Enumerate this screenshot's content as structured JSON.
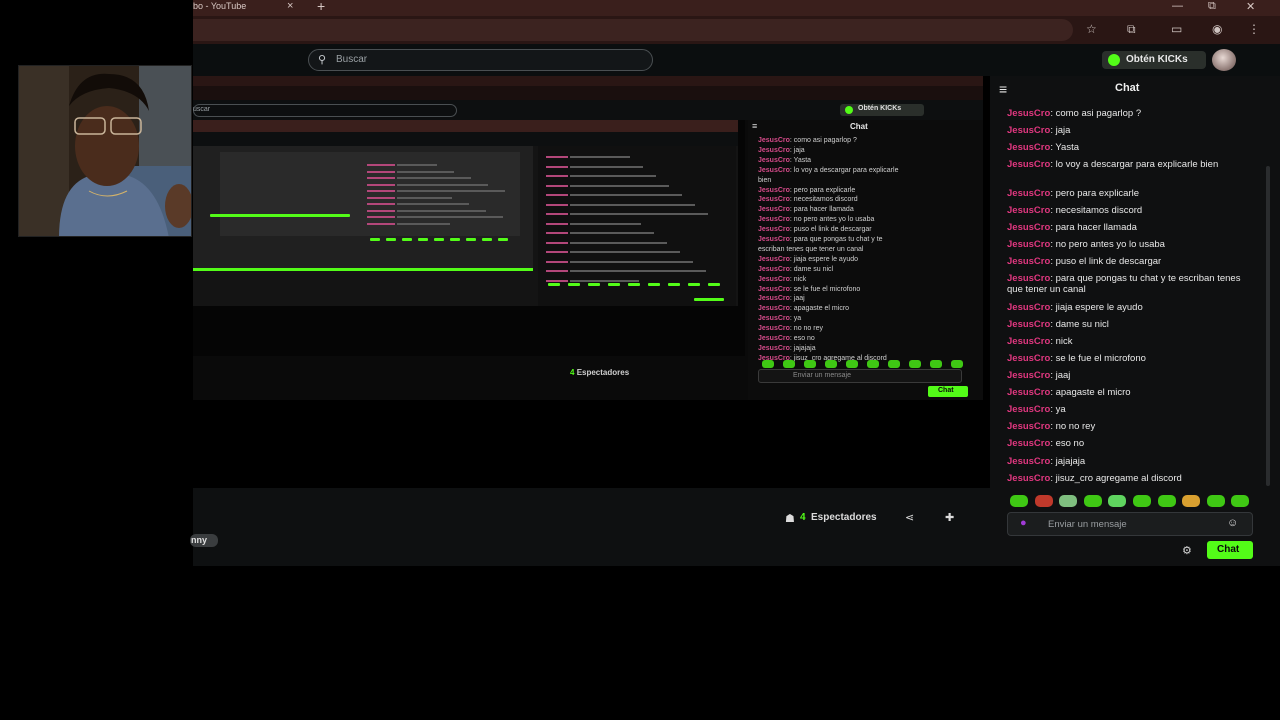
{
  "browser": {
    "tab_title": "bo - YouTube",
    "tab_close": "×",
    "tab_new": "+",
    "win_minimize": "—",
    "win_restore": "⧉",
    "win_close": "✕"
  },
  "header": {
    "search_placeholder": "Buscar",
    "kicks_label": "Obtén KICKs"
  },
  "nested": {
    "search_text": "uscar",
    "kicks_label": "Obtén KICKs",
    "chat_title": "Chat",
    "spect_count": "4",
    "spect_label": "Espectadores",
    "input_placeholder": "Enviar un mensaje",
    "chat_button": "Chat",
    "messages": [
      {
        "user": "JesusCro",
        "text": ": como asi pagarlop ?"
      },
      {
        "user": "JesusCro",
        "text": ": jaja"
      },
      {
        "user": "JesusCro",
        "text": ": Yasta"
      },
      {
        "user": "JesusCro",
        "text": ": lo voy a descargar para explicarle"
      },
      {
        "user": "",
        "text": "bien"
      },
      {
        "user": "JesusCro",
        "text": ": pero para explicarle"
      },
      {
        "user": "JesusCro",
        "text": ": necesitamos discord"
      },
      {
        "user": "JesusCro",
        "text": ": para hacer llamada"
      },
      {
        "user": "JesusCro",
        "text": ": no pero antes yo lo usaba"
      },
      {
        "user": "JesusCro",
        "text": ": puso el link de descargar"
      },
      {
        "user": "JesusCro",
        "text": ": para que pongas tu chat y te"
      },
      {
        "user": "",
        "text": "escriban tenes que tener un canal"
      },
      {
        "user": "JesusCro",
        "text": ": jiaja espere le ayudo"
      },
      {
        "user": "JesusCro",
        "text": ": dame su nicl"
      },
      {
        "user": "JesusCro",
        "text": ": nick"
      },
      {
        "user": "JesusCro",
        "text": ": se le fue el microfono"
      },
      {
        "user": "JesusCro",
        "text": ": jaaj"
      },
      {
        "user": "JesusCro",
        "text": ": apagaste el micro"
      },
      {
        "user": "JesusCro",
        "text": ": ya"
      },
      {
        "user": "JesusCro",
        "text": ": no no rey"
      },
      {
        "user": "JesusCro",
        "text": ": eso no"
      },
      {
        "user": "JesusCro",
        "text": ": jajajaja"
      },
      {
        "user": "JesusCro",
        "text": ": jisuz_cro agregame al discord"
      }
    ]
  },
  "stream_info": {
    "spect_count": "4",
    "spect_label": "Espectadores",
    "name_tag": "nny"
  },
  "chat": {
    "title": "Chat",
    "input_placeholder": "Enviar un mensaje",
    "send_button": "Chat",
    "username_color": "#e0377f",
    "accent": "#53fc18",
    "messages": [
      {
        "user": "JesusCro",
        "text": ": como asi pagarlop ?"
      },
      {
        "user": "JesusCro",
        "text": ": jaja"
      },
      {
        "user": "JesusCro",
        "text": ": Yasta"
      },
      {
        "user": "JesusCro",
        "text": ": lo voy a descargar para explicarle bien"
      },
      {
        "user": "JesusCro",
        "text": ": pero para explicarle"
      },
      {
        "user": "JesusCro",
        "text": ": necesitamos discord"
      },
      {
        "user": "JesusCro",
        "text": ": para hacer llamada"
      },
      {
        "user": "JesusCro",
        "text": ": no pero antes yo lo usaba"
      },
      {
        "user": "JesusCro",
        "text": ": puso el link de descargar"
      },
      {
        "user": "JesusCro",
        "text": ": para que pongas tu chat y te escriban tenes que tener un canal"
      },
      {
        "user": "JesusCro",
        "text": ": jiaja espere le ayudo"
      },
      {
        "user": "JesusCro",
        "text": ": dame su nicl"
      },
      {
        "user": "JesusCro",
        "text": ": nick"
      },
      {
        "user": "JesusCro",
        "text": ": se le fue el microfono"
      },
      {
        "user": "JesusCro",
        "text": ": jaaj"
      },
      {
        "user": "JesusCro",
        "text": ": apagaste el micro"
      },
      {
        "user": "JesusCro",
        "text": ": ya"
      },
      {
        "user": "JesusCro",
        "text": ": no no rey"
      },
      {
        "user": "JesusCro",
        "text": ": eso no"
      },
      {
        "user": "JesusCro",
        "text": ": jajajaja"
      },
      {
        "user": "JesusCro",
        "text": ": jisuz_cro agregame al discord"
      }
    ],
    "emotes": [
      "emote-1",
      "emote-2",
      "emote-3",
      "emote-4",
      "emote-5",
      "emote-6",
      "emote-7",
      "emote-8",
      "emote-9",
      "emote-10"
    ]
  },
  "icons": {
    "search": "search-icon",
    "chat_collapse": "chat-collapse-icon",
    "viewers": "viewers-icon",
    "share": "share-icon",
    "follow": "follow-icon",
    "mic": "mic-icon",
    "emoji": "emoji-icon",
    "settings": "settings-icon"
  }
}
